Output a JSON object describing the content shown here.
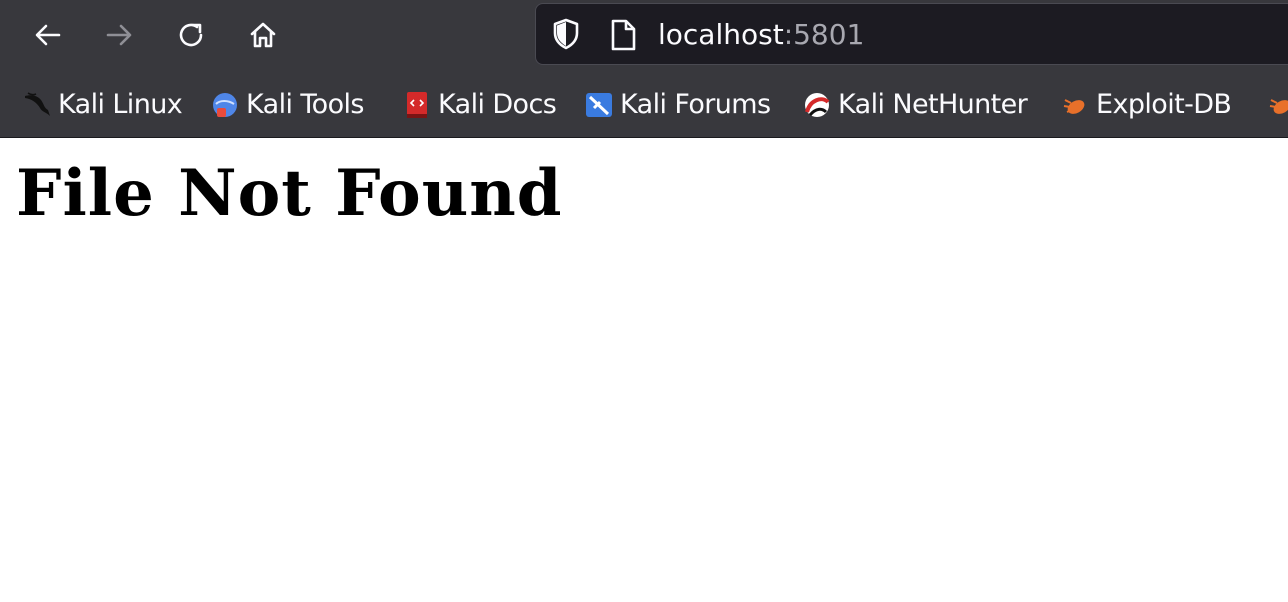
{
  "browser": {
    "address_bar": {
      "host": "localhost",
      "port": ":5801"
    },
    "bookmarks": [
      {
        "label": "Kali Linux",
        "icon": "kali-dragon-icon"
      },
      {
        "label": "Kali Tools",
        "icon": "kali-tools-icon"
      },
      {
        "label": "Kali Docs",
        "icon": "kali-docs-icon"
      },
      {
        "label": "Kali Forums",
        "icon": "kali-forums-icon"
      },
      {
        "label": "Kali NetHunter",
        "icon": "kali-nethunter-icon"
      },
      {
        "label": "Exploit-DB",
        "icon": "exploit-db-icon"
      }
    ]
  },
  "page": {
    "heading": "File Not Found"
  }
}
